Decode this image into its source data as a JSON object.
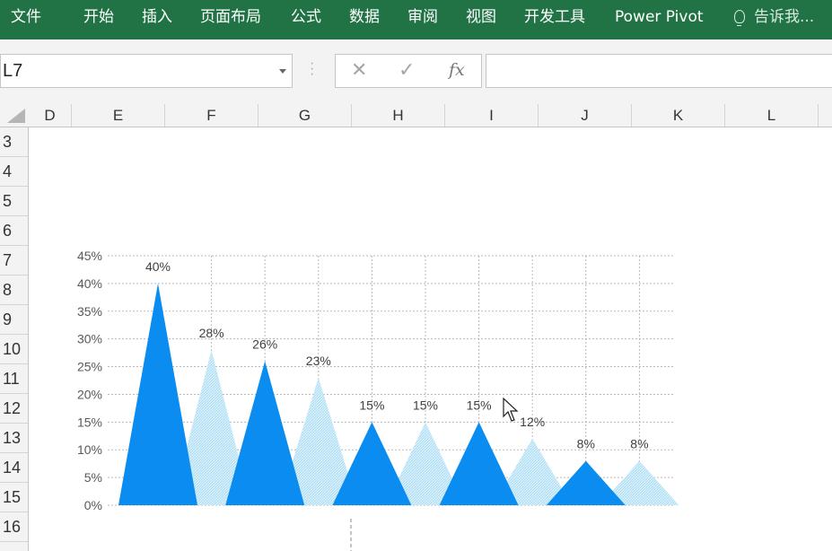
{
  "ribbon": {
    "tabs": [
      "文件",
      "开始",
      "插入",
      "页面布局",
      "公式",
      "数据",
      "审阅",
      "视图",
      "开发工具",
      "Power Pivot"
    ],
    "tell_me": "告诉我..."
  },
  "formula_bar": {
    "name_box": "L7",
    "cancel_icon": "✕",
    "enter_icon": "✓",
    "fx_label": "fx",
    "formula_value": ""
  },
  "columns": [
    "D",
    "E",
    "F",
    "G",
    "H",
    "I",
    "J",
    "K",
    "L"
  ],
  "rows": [
    "3",
    "4",
    "5",
    "6",
    "7",
    "8",
    "9",
    "10",
    "11",
    "12",
    "13",
    "14",
    "15",
    "16"
  ],
  "colors": {
    "ribbon": "#217346",
    "solid_series": "#0A8CF0",
    "light_series": "#BFE6F8"
  },
  "chart_data": {
    "type": "area",
    "subtype": "triangle-columns",
    "values": [
      0.4,
      0.28,
      0.26,
      0.23,
      0.15,
      0.15,
      0.15,
      0.12,
      0.08,
      0.08
    ],
    "data_labels": [
      "40%",
      "28%",
      "26%",
      "23%",
      "15%",
      "15%",
      "15%",
      "12%",
      "8%",
      "8%"
    ],
    "fill_pattern": [
      "solid",
      "light",
      "solid",
      "light",
      "solid",
      "light",
      "solid",
      "light",
      "solid",
      "light"
    ],
    "y_ticks": [
      "0%",
      "5%",
      "10%",
      "15%",
      "20%",
      "25%",
      "30%",
      "35%",
      "40%",
      "45%"
    ],
    "ylim": [
      0,
      0.45
    ],
    "grid": true,
    "legend": "none",
    "title": "",
    "xlabel": "",
    "ylabel": ""
  }
}
